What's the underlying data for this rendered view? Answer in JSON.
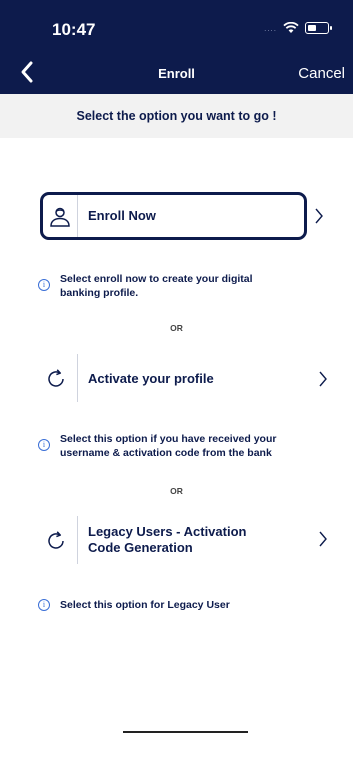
{
  "status_bar": {
    "time": "10:47",
    "signal": "....",
    "battery_level": 0.45
  },
  "nav": {
    "title": "Enroll",
    "cancel_label": "Cancel"
  },
  "instruction": "Select the option you want to go !",
  "options": [
    {
      "label": "Enroll Now",
      "icon": "user-icon",
      "info": [
        "Select enroll now to create your digital",
        "banking profile."
      ]
    },
    {
      "label": "Activate your profile",
      "icon": "refresh-icon",
      "info": [
        "Select this option if you have received your",
        "username & activation code from the bank"
      ]
    },
    {
      "label": [
        "Legacy Users - Activation",
        "Code Generation"
      ],
      "icon": "refresh-icon",
      "info": [
        "Select this option for Legacy User"
      ]
    }
  ],
  "or_label": "OR",
  "colors": {
    "navy": "#0d1b4c",
    "info_blue": "#3b6fd6",
    "instruction_bg": "#f2f2f2"
  }
}
